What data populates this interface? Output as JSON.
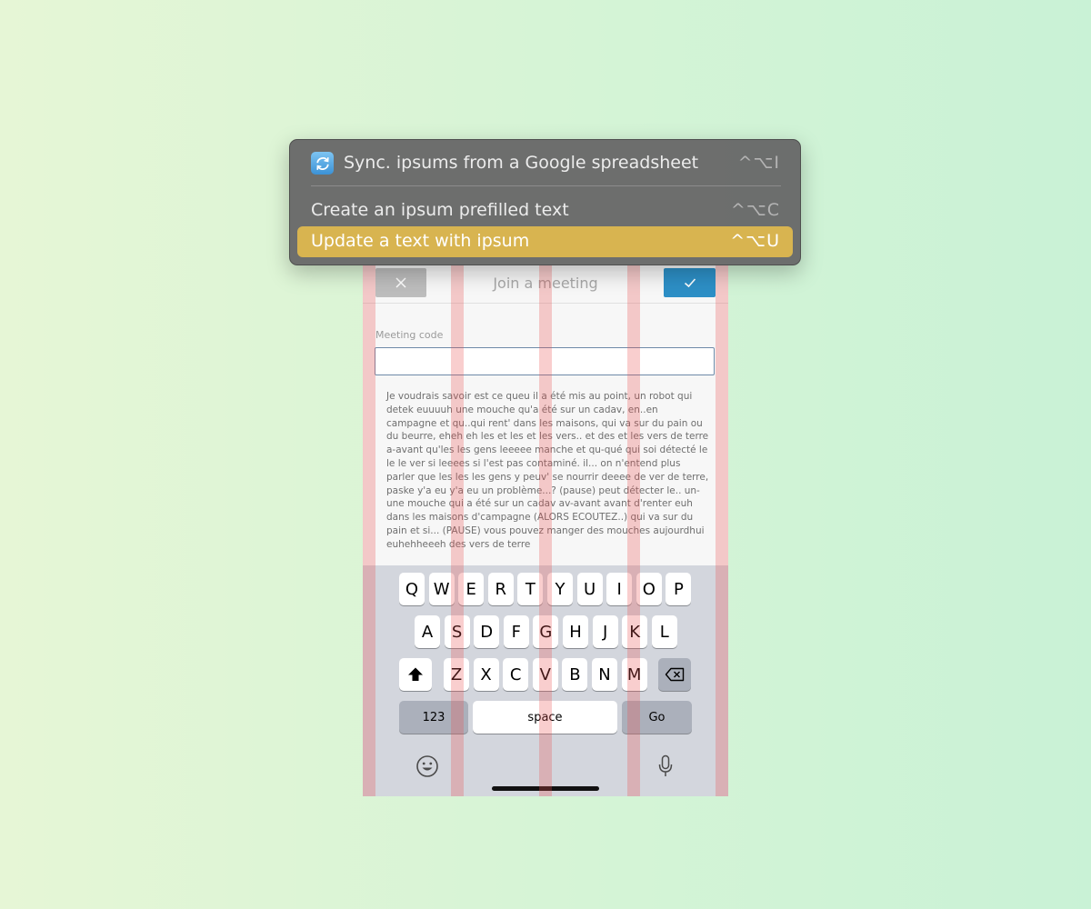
{
  "menu": {
    "items": [
      {
        "label": "Sync. ipsums from a Google spreadsheet",
        "shortcut": "^⌥I",
        "icon": "sync-icon",
        "selected": false
      },
      {
        "label": "Create an ipsum prefilled text",
        "shortcut": "^⌥C",
        "selected": false
      },
      {
        "label": "Update a text with ipsum",
        "shortcut": "^⌥U",
        "selected": true
      }
    ]
  },
  "form": {
    "title": "Join a meeting",
    "cancel_icon": "close-icon",
    "confirm_icon": "check-icon",
    "field_label": "Meeting code",
    "field_value": "",
    "body_text": "Je voudrais savoir est ce queu il a été mis au point, un robot qui detek euuuuh une mouche qu'a été sur un cadav, en..en campagne et qu..qui rent' dans les maisons, qui va sur du pain ou du beurre, eheh eh les et les et les vers.. et des et les vers de terre a-avant qu'les les gens leeeee manche et qu-qué qui soi détecté le le le ver si leeees si l'est pas contaminé. il... on n'entend plus parler que les les les gens y peuv' se nourrir deeee de ver de terre, paske y'a eu y'a eu un problème...? (pause) peut détecter le.. un-une mouche qui a été sur un cadav av-avant avant d'renter euh dans les maisons d'campagne (ALORS ECOUTEZ..) qui va sur du pain et si... (PAUSE) vous pouvez manger des mouches aujourdhui euhehheeeh des vers de terre"
  },
  "keyboard": {
    "row1": [
      "Q",
      "W",
      "E",
      "R",
      "T",
      "Y",
      "U",
      "I",
      "O",
      "P"
    ],
    "row2": [
      "A",
      "S",
      "D",
      "F",
      "G",
      "H",
      "J",
      "K",
      "L"
    ],
    "row3": [
      "Z",
      "X",
      "C",
      "V",
      "B",
      "N",
      "M"
    ],
    "numbers_label": "123",
    "space_label": "space",
    "go_label": "Go",
    "icons": [
      "shift-icon",
      "backspace-icon",
      "emoji-icon",
      "microphone-icon"
    ]
  },
  "colors": {
    "menu_highlight": "#d8b450",
    "confirm_button": "#2d8fc6",
    "guide_overlay": "#e85050"
  }
}
